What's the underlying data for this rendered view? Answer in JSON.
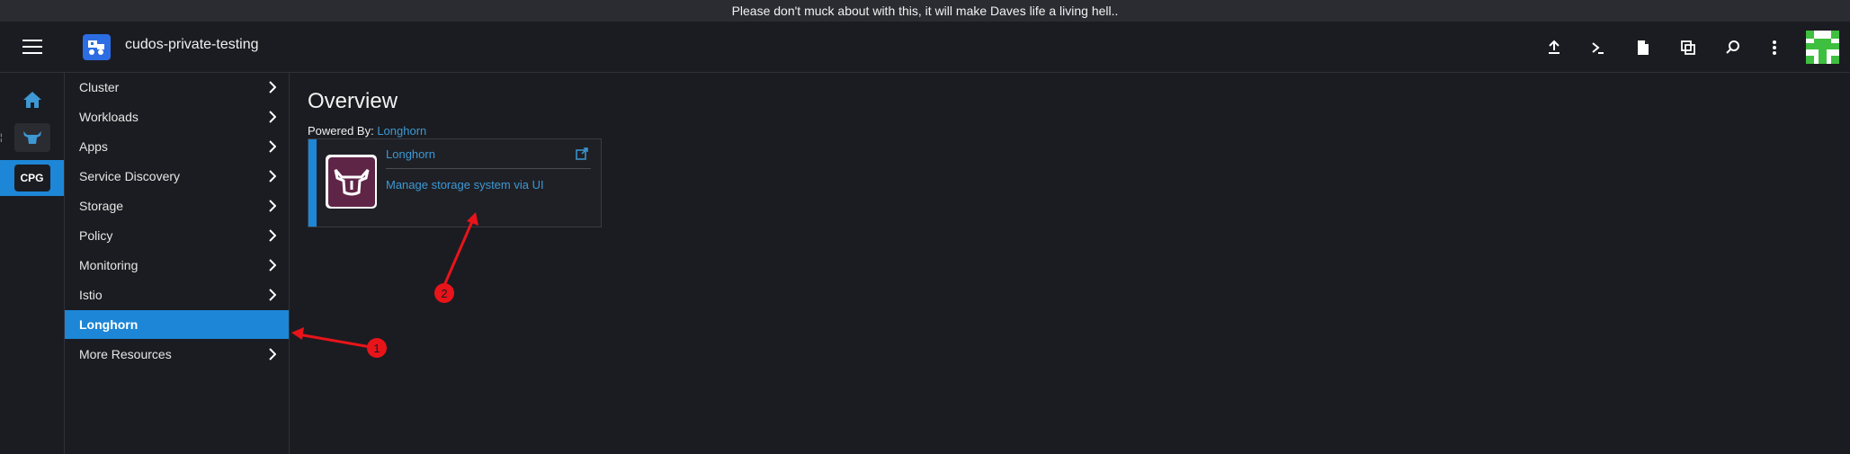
{
  "banner": {
    "text": "Please don't muck about with this, it will make Daves life a living hell.."
  },
  "header": {
    "cluster_name": "cudos-private-testing",
    "icons": [
      "upload-icon",
      "terminal-icon",
      "file-icon",
      "copy-icon",
      "search-icon",
      "more-vert-icon"
    ]
  },
  "rail": {
    "home_icon": "home-icon",
    "local_icon": "longhorn-cow-icon",
    "active_badge": "CPG",
    "stray_mark": "¦"
  },
  "sidebar": {
    "items": [
      {
        "label": "Cluster",
        "has_chevron": true
      },
      {
        "label": "Workloads",
        "has_chevron": true
      },
      {
        "label": "Apps",
        "has_chevron": true
      },
      {
        "label": "Service Discovery",
        "has_chevron": true
      },
      {
        "label": "Storage",
        "has_chevron": true
      },
      {
        "label": "Policy",
        "has_chevron": true
      },
      {
        "label": "Monitoring",
        "has_chevron": true
      },
      {
        "label": "Istio",
        "has_chevron": true
      },
      {
        "label": "Longhorn",
        "has_chevron": false,
        "active": true
      },
      {
        "label": "More Resources",
        "has_chevron": true
      }
    ]
  },
  "main": {
    "title": "Overview",
    "powered_by_label": "Powered By:",
    "powered_by_link": "Longhorn",
    "card": {
      "name": "Longhorn",
      "description": "Manage storage system via UI",
      "icon": "external-link-icon",
      "logo": "longhorn-logo"
    }
  },
  "annotations": [
    {
      "number": "1"
    },
    {
      "number": "2"
    }
  ],
  "colors": {
    "accent": "#1d86d6",
    "link": "#3d98d3",
    "background": "#1b1c21",
    "annotation": "#e8141a"
  }
}
